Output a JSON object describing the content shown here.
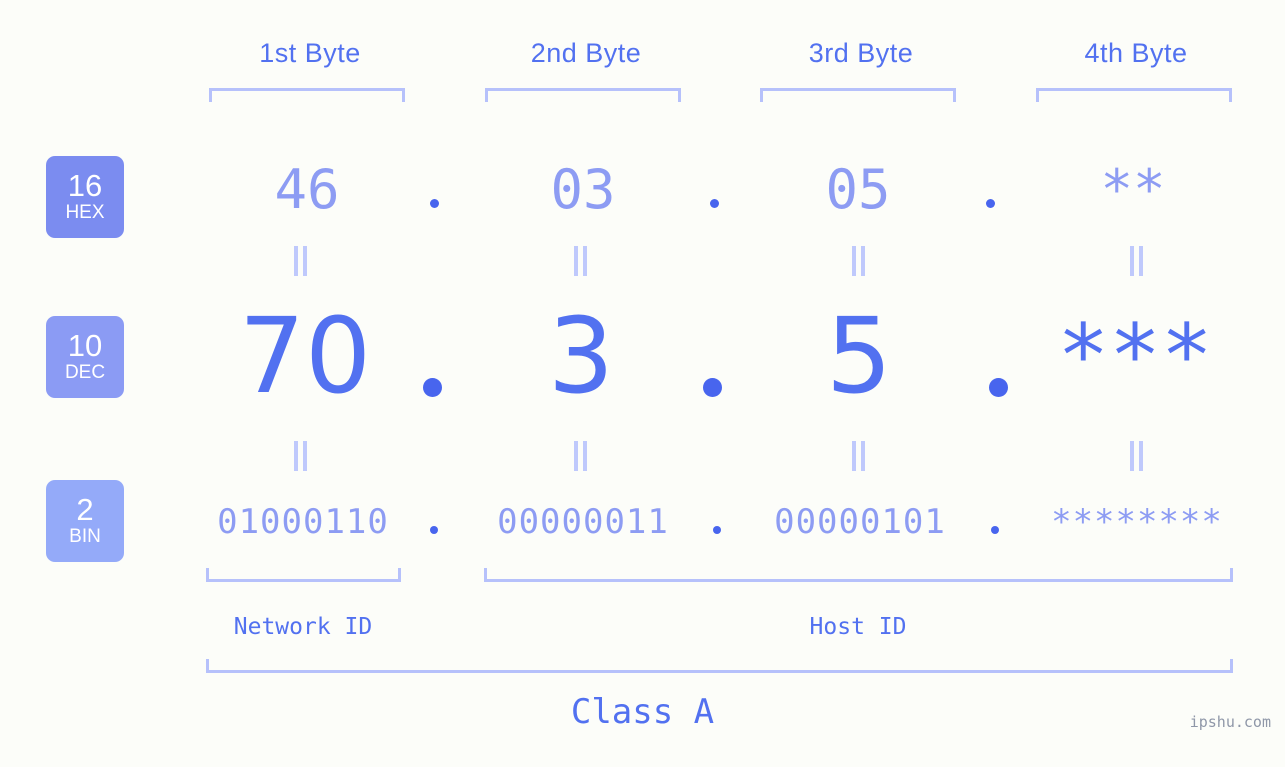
{
  "background_color": "#fcfdf9",
  "accent_color": "#5271f0",
  "muted_color": "#8d9cf3",
  "bracket_color": "#b6c1fb",
  "byte_headers": [
    {
      "label": "1st Byte"
    },
    {
      "label": "2nd Byte"
    },
    {
      "label": "3rd Byte"
    },
    {
      "label": "4th Byte"
    }
  ],
  "bases": {
    "hex": {
      "number": "16",
      "name": "HEX",
      "badge_color": "#7b8cf0"
    },
    "dec": {
      "number": "10",
      "name": "DEC",
      "badge_color": "#8b9bf4"
    },
    "bin": {
      "number": "2",
      "name": "BIN",
      "badge_color": "#94aaf9"
    }
  },
  "rows": {
    "hex": {
      "values": [
        "46",
        "03",
        "05",
        "**"
      ]
    },
    "dec": {
      "values": [
        "70",
        "3",
        "5",
        "***"
      ]
    },
    "bin": {
      "values": [
        "01000110",
        "00000011",
        "00000101",
        "********"
      ]
    }
  },
  "separator": ".",
  "equals_glyph": "=",
  "segments": {
    "network_id": "Network ID",
    "host_id": "Host ID"
  },
  "class_label": "Class A",
  "watermark": "ipshu.com"
}
